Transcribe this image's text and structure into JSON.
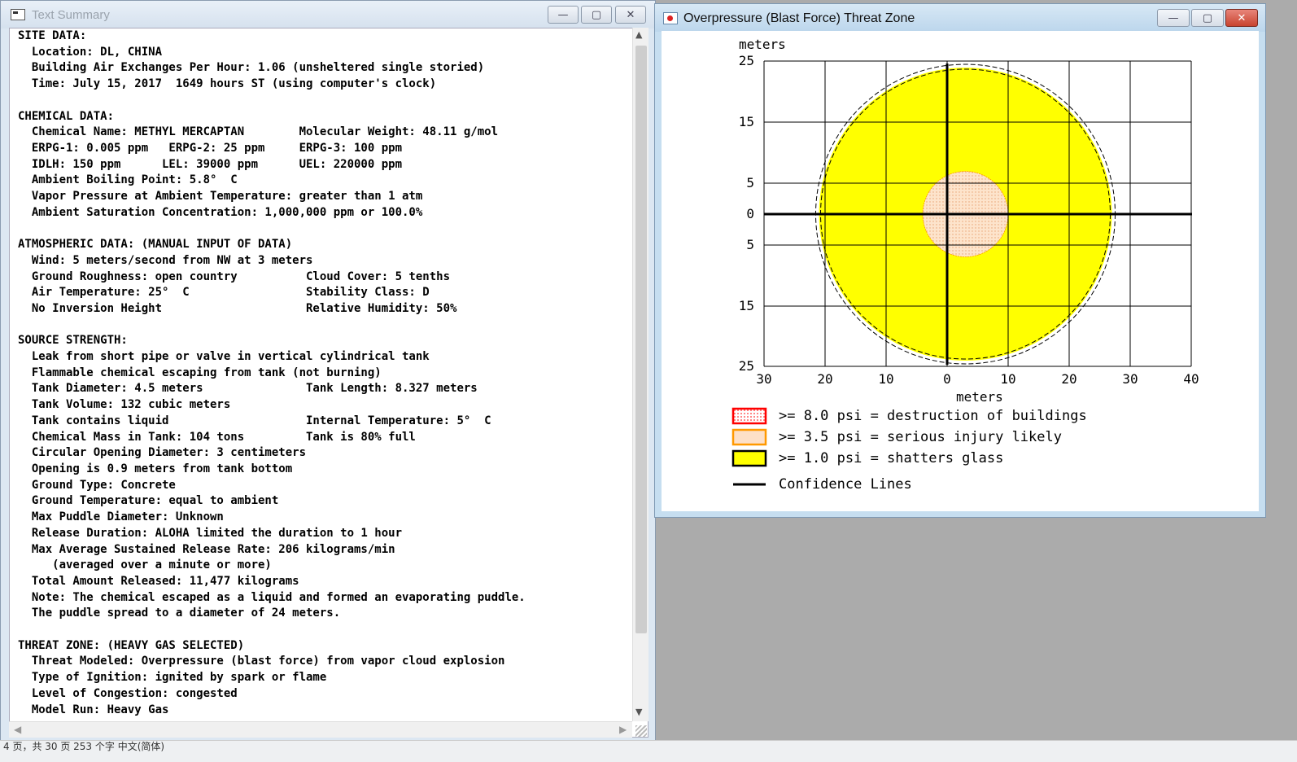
{
  "text_window": {
    "title": "Text Summary",
    "buttons": [
      "—",
      "▢",
      "✕"
    ],
    "lines": [
      "SITE DATA:",
      "  Location: DL, CHINA",
      "  Building Air Exchanges Per Hour: 1.06 (unsheltered single storied)",
      "  Time: July 15, 2017  1649 hours ST (using computer's clock)",
      "",
      "CHEMICAL DATA:",
      "  Chemical Name: METHYL MERCAPTAN        Molecular Weight: 48.11 g/mol",
      "  ERPG-1: 0.005 ppm   ERPG-2: 25 ppm     ERPG-3: 100 ppm",
      "  IDLH: 150 ppm      LEL: 39000 ppm      UEL: 220000 ppm",
      "  Ambient Boiling Point: 5.8°  C",
      "  Vapor Pressure at Ambient Temperature: greater than 1 atm",
      "  Ambient Saturation Concentration: 1,000,000 ppm or 100.0%",
      "",
      "ATMOSPHERIC DATA: (MANUAL INPUT OF DATA)",
      "  Wind: 5 meters/second from NW at 3 meters",
      "  Ground Roughness: open country          Cloud Cover: 5 tenths",
      "  Air Temperature: 25°  C                 Stability Class: D",
      "  No Inversion Height                     Relative Humidity: 50%",
      "",
      "SOURCE STRENGTH:",
      "  Leak from short pipe or valve in vertical cylindrical tank",
      "  Flammable chemical escaping from tank (not burning)",
      "  Tank Diameter: 4.5 meters               Tank Length: 8.327 meters",
      "  Tank Volume: 132 cubic meters",
      "  Tank contains liquid                    Internal Temperature: 5°  C",
      "  Chemical Mass in Tank: 104 tons         Tank is 80% full",
      "  Circular Opening Diameter: 3 centimeters",
      "  Opening is 0.9 meters from tank bottom",
      "  Ground Type: Concrete",
      "  Ground Temperature: equal to ambient",
      "  Max Puddle Diameter: Unknown",
      "  Release Duration: ALOHA limited the duration to 1 hour",
      "  Max Average Sustained Release Rate: 206 kilograms/min",
      "     (averaged over a minute or more)",
      "  Total Amount Released: 11,477 kilograms",
      "  Note: The chemical escaped as a liquid and formed an evaporating puddle.",
      "  The puddle spread to a diameter of 24 meters.",
      "",
      "THREAT ZONE: (HEAVY GAS SELECTED)",
      "  Threat Modeled: Overpressure (blast force) from vapor cloud explosion",
      "  Type of Ignition: ignited by spark or flame",
      "  Level of Congestion: congested",
      "  Model Run: Heavy Gas"
    ]
  },
  "status_bar": "4 页，共 30 页    253 个字    中文(简体)",
  "threat_window": {
    "title": "Overpressure (Blast Force) Threat Zone",
    "buttons": [
      "—",
      "▢",
      "✕"
    ],
    "chart_data": {
      "type": "threat-zone-plot",
      "y_unit": "meters",
      "x_unit": "meters",
      "x_ticks": [
        "30",
        "20",
        "10",
        "0",
        "10",
        "20",
        "30",
        "40"
      ],
      "y_ticks": [
        "25",
        "15",
        "5",
        "0",
        "5",
        "15",
        "25"
      ],
      "zones": [
        {
          "label": ">= 8.0 psi = destruction of buildings",
          "color": "#ff0000",
          "fill": "dotted-white",
          "visible_extent": "none"
        },
        {
          "label": ">= 3.5 psi = serious injury likely",
          "color": "#ff9900",
          "fill": "#fde0c8",
          "center_x": 3,
          "radius_m": 7
        },
        {
          "label": ">= 1.0 psi = shatters glass",
          "color": "#000000",
          "fill": "#ffff00",
          "center_x": 3,
          "radius_m": 24
        }
      ],
      "confidence_label": "Confidence Lines",
      "grid": true
    }
  }
}
